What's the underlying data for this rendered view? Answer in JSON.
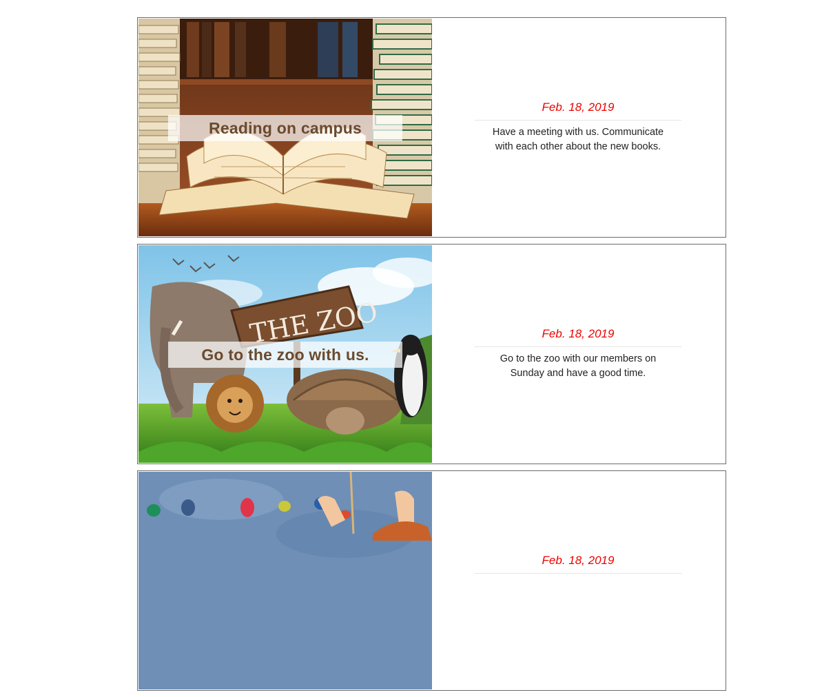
{
  "events": [
    {
      "caption": "Reading on campus",
      "date": "Feb. 18, 2019",
      "description": "Have a meeting with us. Communicate with each other about the new books.",
      "image": "books-photo"
    },
    {
      "caption": "Go to the zoo with us.",
      "date": "Feb. 18, 2019",
      "description": "Go to the zoo with our members on Sunday and have a good time.",
      "image": "zoo-photo",
      "sign_text": "THE ZOO"
    },
    {
      "caption": "",
      "date": "Feb. 18, 2019",
      "description": "",
      "image": "climbing-wall-photo"
    }
  ],
  "colors": {
    "date": "#ee0000",
    "card_border": "#6b6b6b"
  }
}
